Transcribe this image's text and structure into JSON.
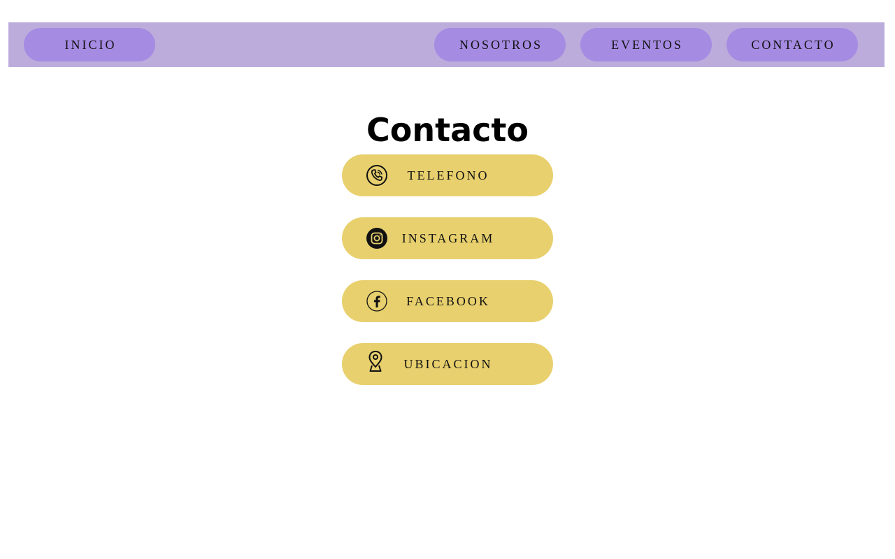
{
  "nav": {
    "items": [
      {
        "label": "INICIO"
      },
      {
        "label": "NOSOTROS"
      },
      {
        "label": "EVENTOS"
      },
      {
        "label": "CONTACTO"
      }
    ]
  },
  "page": {
    "title": "Contacto"
  },
  "contacts": [
    {
      "label": "TELEFONO",
      "icon": "phone-icon"
    },
    {
      "label": "INSTAGRAM",
      "icon": "instagram-icon"
    },
    {
      "label": "FACEBOOK",
      "icon": "facebook-icon"
    },
    {
      "label": "UBICACION",
      "icon": "location-pin-icon"
    }
  ],
  "colors": {
    "navbar_bg": "#bcacdc",
    "nav_button": "#a58be2",
    "contact_button": "#e8d06e",
    "text": "#111111"
  }
}
